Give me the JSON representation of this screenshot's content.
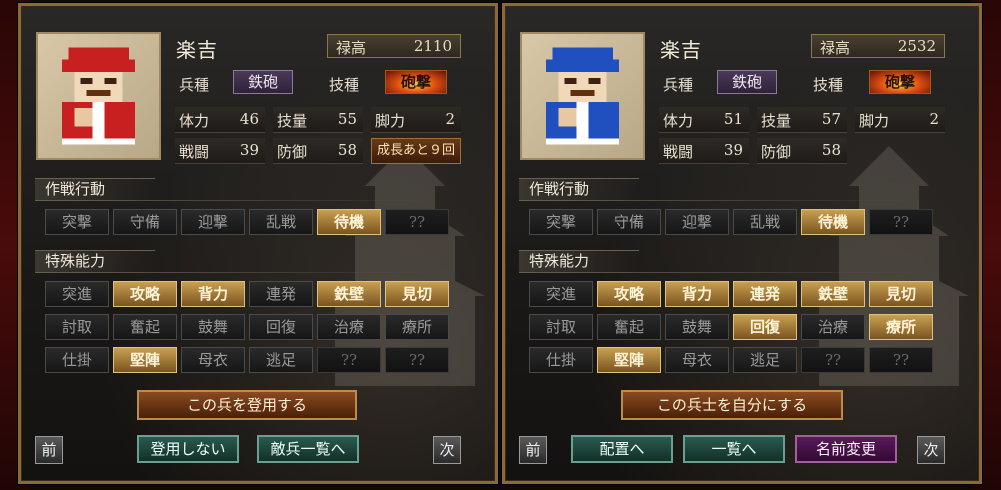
{
  "panels": [
    {
      "name": "楽吉",
      "stipend_label": "禄高",
      "stipend_value": "2110",
      "unit_label": "兵種",
      "unit_value": "鉄砲",
      "technique_label": "技種",
      "technique_value": "砲撃",
      "stats": [
        {
          "label": "体力",
          "value": "46"
        },
        {
          "label": "技量",
          "value": "55"
        },
        {
          "label": "脚力",
          "value": "2"
        },
        {
          "label": "戦闘",
          "value": "39"
        },
        {
          "label": "防御",
          "value": "58"
        }
      ],
      "growth_text": "成長あと９回",
      "tactics_title": "作戦行動",
      "tactics": [
        {
          "label": "突撃",
          "state": "off"
        },
        {
          "label": "守備",
          "state": "off"
        },
        {
          "label": "迎撃",
          "state": "off"
        },
        {
          "label": "乱戦",
          "state": "off"
        },
        {
          "label": "待機",
          "state": "on"
        },
        {
          "label": "??",
          "state": "dim"
        }
      ],
      "abilities_title": "特殊能力",
      "abilities": [
        {
          "label": "突進",
          "state": "off"
        },
        {
          "label": "攻略",
          "state": "on"
        },
        {
          "label": "背力",
          "state": "on"
        },
        {
          "label": "連発",
          "state": "off"
        },
        {
          "label": "鉄壁",
          "state": "on"
        },
        {
          "label": "見切",
          "state": "on"
        },
        {
          "label": "討取",
          "state": "off"
        },
        {
          "label": "奮起",
          "state": "off"
        },
        {
          "label": "鼓舞",
          "state": "off"
        },
        {
          "label": "回復",
          "state": "off"
        },
        {
          "label": "治療",
          "state": "off"
        },
        {
          "label": "療所",
          "state": "off"
        },
        {
          "label": "仕掛",
          "state": "off"
        },
        {
          "label": "堅陣",
          "state": "on"
        },
        {
          "label": "母衣",
          "state": "off"
        },
        {
          "label": "逃足",
          "state": "off"
        },
        {
          "label": "??",
          "state": "dim"
        },
        {
          "label": "??",
          "state": "dim"
        }
      ],
      "primary_button": "この兵を登用する",
      "prev_label": "前",
      "next_label": "次",
      "actions": [
        {
          "label": "登用しない",
          "style": "teal"
        },
        {
          "label": "敵兵一覧へ",
          "style": "teal"
        }
      ],
      "uniform_color": "#c82020"
    },
    {
      "name": "楽吉",
      "stipend_label": "禄高",
      "stipend_value": "2532",
      "unit_label": "兵種",
      "unit_value": "鉄砲",
      "technique_label": "技種",
      "technique_value": "砲撃",
      "stats": [
        {
          "label": "体力",
          "value": "51"
        },
        {
          "label": "技量",
          "value": "57"
        },
        {
          "label": "脚力",
          "value": "2"
        },
        {
          "label": "戦闘",
          "value": "39"
        },
        {
          "label": "防御",
          "value": "58"
        }
      ],
      "growth_text": "",
      "tactics_title": "作戦行動",
      "tactics": [
        {
          "label": "突撃",
          "state": "off"
        },
        {
          "label": "守備",
          "state": "off"
        },
        {
          "label": "迎撃",
          "state": "off"
        },
        {
          "label": "乱戦",
          "state": "off"
        },
        {
          "label": "待機",
          "state": "on"
        },
        {
          "label": "??",
          "state": "dim"
        }
      ],
      "abilities_title": "特殊能力",
      "abilities": [
        {
          "label": "突進",
          "state": "off"
        },
        {
          "label": "攻略",
          "state": "on"
        },
        {
          "label": "背力",
          "state": "on"
        },
        {
          "label": "連発",
          "state": "on"
        },
        {
          "label": "鉄壁",
          "state": "on"
        },
        {
          "label": "見切",
          "state": "on"
        },
        {
          "label": "討取",
          "state": "off"
        },
        {
          "label": "奮起",
          "state": "off"
        },
        {
          "label": "鼓舞",
          "state": "off"
        },
        {
          "label": "回復",
          "state": "on"
        },
        {
          "label": "治療",
          "state": "off"
        },
        {
          "label": "療所",
          "state": "on"
        },
        {
          "label": "仕掛",
          "state": "off"
        },
        {
          "label": "堅陣",
          "state": "on"
        },
        {
          "label": "母衣",
          "state": "off"
        },
        {
          "label": "逃足",
          "state": "off"
        },
        {
          "label": "??",
          "state": "dim"
        },
        {
          "label": "??",
          "state": "dim"
        }
      ],
      "primary_button": "この兵士を自分にする",
      "prev_label": "前",
      "next_label": "次",
      "actions": [
        {
          "label": "配置へ",
          "style": "teal"
        },
        {
          "label": "一覧へ",
          "style": "teal"
        },
        {
          "label": "名前変更",
          "style": "purple"
        }
      ],
      "uniform_color": "#2050c0"
    }
  ]
}
